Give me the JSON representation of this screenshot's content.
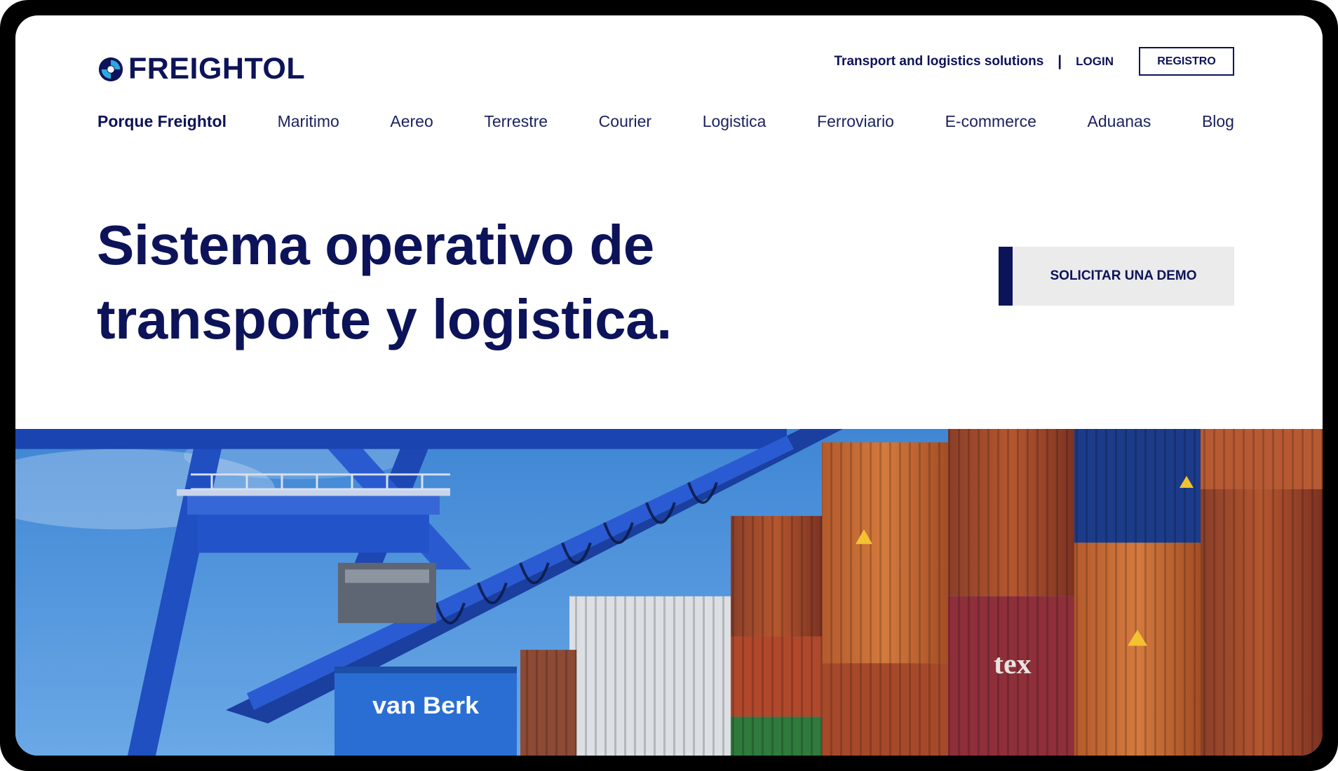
{
  "brand": {
    "name": "FREIGHTOL",
    "primary_color": "#0d1359",
    "logo_icon": "freightol-swirl-logo-icon"
  },
  "header": {
    "tagline": "Transport and logistics solutions",
    "separator": "|",
    "login_label": "LOGIN",
    "register_label": "REGISTRO"
  },
  "nav": {
    "items": [
      {
        "label": "Porque Freightol",
        "active": true
      },
      {
        "label": "Maritimo"
      },
      {
        "label": "Aereo"
      },
      {
        "label": "Terrestre"
      },
      {
        "label": "Courier"
      },
      {
        "label": "Logistica"
      },
      {
        "label": "Ferroviario"
      },
      {
        "label": "E-commerce"
      },
      {
        "label": "Aduanas"
      },
      {
        "label": "Blog"
      }
    ]
  },
  "hero": {
    "title_line1": "Sistema operativo de",
    "title_line2": "transporte y logistica.",
    "cta_label": "SOLICITAR UNA DEMO"
  },
  "photo": {
    "description_icon": "port-container-crane-photo",
    "crane_sign": "van Berk",
    "container_label": "tex"
  }
}
